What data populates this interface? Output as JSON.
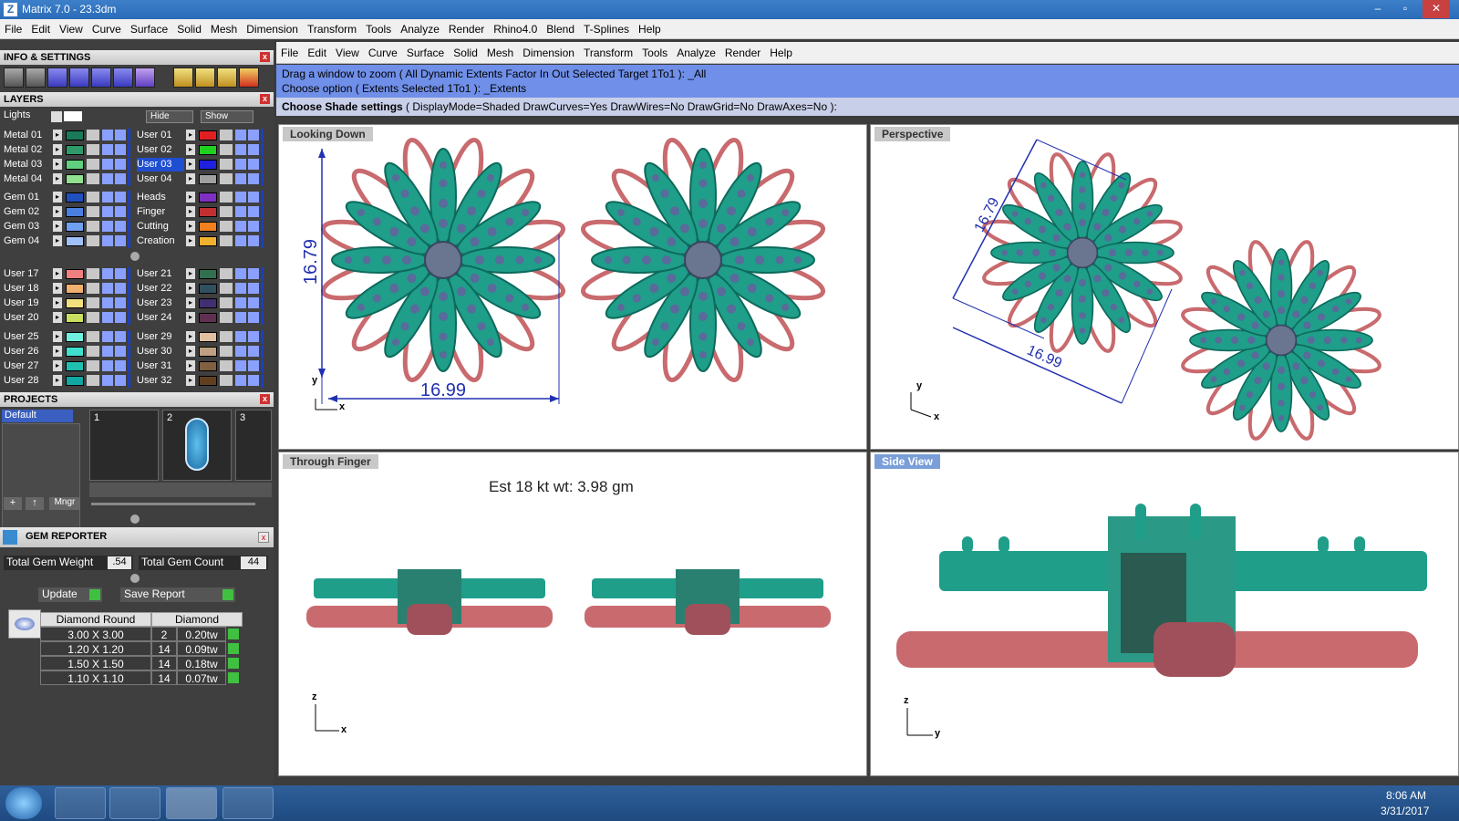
{
  "window": {
    "title": "Matrix 7.0 - 23.3dm",
    "btn_min": "–",
    "btn_max": "▫",
    "btn_close": "✕"
  },
  "main_menu": [
    "File",
    "Edit",
    "View",
    "Curve",
    "Surface",
    "Solid",
    "Mesh",
    "Dimension",
    "Transform",
    "Tools",
    "Analyze",
    "Render",
    "Rhino4.0",
    "Blend",
    "T-Splines",
    "Help"
  ],
  "left_panel": {
    "info_settings": "INFO & SETTINGS",
    "layers_title": "LAYERS",
    "lights_label": "Lights",
    "hide_label": "Hide",
    "show_label": "Show",
    "layers_left": [
      {
        "name": "Metal 01",
        "color": "#1a7a5a"
      },
      {
        "name": "Metal 02",
        "color": "#2e9a6a"
      },
      {
        "name": "Metal 03",
        "color": "#60d080"
      },
      {
        "name": "Metal 04",
        "color": "#90e090"
      },
      {
        "name": "Gem 01",
        "color": "#2050c0"
      },
      {
        "name": "Gem 02",
        "color": "#4a80e0"
      },
      {
        "name": "Gem 03",
        "color": "#70a0f0"
      },
      {
        "name": "Gem 04",
        "color": "#a0c0f8"
      },
      {
        "name": "User 17",
        "color": "#f08080"
      },
      {
        "name": "User 18",
        "color": "#f0b070"
      },
      {
        "name": "User 19",
        "color": "#f0e080"
      },
      {
        "name": "User 20",
        "color": "#c8e060"
      },
      {
        "name": "User 25",
        "color": "#70f0e0"
      },
      {
        "name": "User 26",
        "color": "#40e0d0"
      },
      {
        "name": "User 27",
        "color": "#20c0b0"
      },
      {
        "name": "User 28",
        "color": "#10a8a0"
      }
    ],
    "layers_right": [
      {
        "name": "User 01",
        "color": "#e02020"
      },
      {
        "name": "User 02",
        "color": "#20d020"
      },
      {
        "name": "User 03",
        "color": "#2020e0"
      },
      {
        "name": "User 04",
        "color": "#a0a0a0"
      },
      {
        "name": "Heads",
        "color": "#8030c0"
      },
      {
        "name": "Finger",
        "color": "#c03030"
      },
      {
        "name": "Cutting",
        "color": "#f08020"
      },
      {
        "name": "Creation",
        "color": "#f0b030"
      },
      {
        "name": "User 21",
        "color": "#307050"
      },
      {
        "name": "User 22",
        "color": "#305060"
      },
      {
        "name": "User 23",
        "color": "#403070"
      },
      {
        "name": "User 24",
        "color": "#603050"
      },
      {
        "name": "User 29",
        "color": "#e0c0a0"
      },
      {
        "name": "User 30",
        "color": "#c0a080"
      },
      {
        "name": "User 31",
        "color": "#806040"
      },
      {
        "name": "User 32",
        "color": "#604020"
      }
    ],
    "projects_title": "PROJECTS",
    "project_default": "Default",
    "project_slot_1": "1",
    "project_slot_2": "2",
    "project_slot_3": "3",
    "mngr_label": "Mngr",
    "gem_reporter_title": "GEM REPORTER",
    "total_weight_label": "Total Gem Weight",
    "total_weight_value": ".54",
    "total_count_label": "Total Gem Count",
    "total_count_value": "44",
    "update_label": "Update",
    "save_report_label": "Save Report",
    "table_header_1": "Diamond Round",
    "table_header_2": "Diamond",
    "gem_rows": [
      {
        "size": "3.00 X 3.00",
        "count": "2",
        "wt": "0.20tw"
      },
      {
        "size": "1.20 X 1.20",
        "count": "14",
        "wt": "0.09tw"
      },
      {
        "size": "1.50 X 1.50",
        "count": "14",
        "wt": "0.18tw"
      },
      {
        "size": "1.10 X 1.10",
        "count": "14",
        "wt": "0.07tw"
      }
    ]
  },
  "cmd_menu": [
    "File",
    "Edit",
    "View",
    "Curve",
    "Surface",
    "Solid",
    "Mesh",
    "Dimension",
    "Transform",
    "Tools",
    "Analyze",
    "Render",
    "Help"
  ],
  "cmd_history": [
    "Drag a window to zoom ( All  Dynamic  Extents  Factor  In  Out  Selected  Target  1To1 ): _All",
    "Choose option ( Extents  Selected  1To1 ): _Extents"
  ],
  "cmd_prompt_bold": "Choose Shade settings",
  "cmd_prompt_rest": "( DisplayMode=Shaded  DrawCurves=Yes  DrawWires=No  DrawGrid=No  DrawAxes=No ):",
  "viewports": {
    "top_label": "Looking Down",
    "persp_label": "Perspective",
    "front_label": "Through Finger",
    "side_label": "Side View",
    "dim_height": "16.79",
    "dim_width": "16.99",
    "estimate": "Est 18 kt wt: 3.98 gm",
    "axis_x": "x",
    "axis_y": "y",
    "axis_z": "z"
  },
  "taskbar": {
    "time": "8:06 AM",
    "date": "3/31/2017"
  },
  "colors": {
    "teal": "#1f9e8a",
    "rose": "#c86a6e",
    "accent": "#6f8fe8"
  }
}
